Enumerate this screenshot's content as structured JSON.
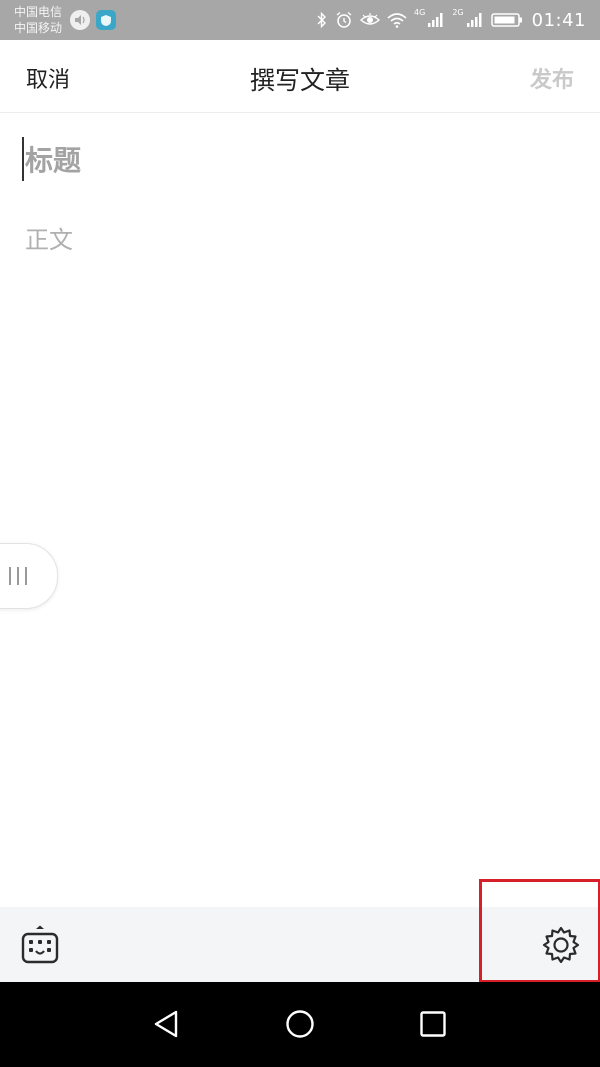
{
  "status_bar": {
    "carrier_primary": "中国电信",
    "carrier_secondary": "中国移动",
    "network_label_1": "4G",
    "network_label_2": "2G",
    "time": "01:41",
    "icons": [
      "volume-icon",
      "shield-icon",
      "bluetooth-icon",
      "alarm-icon",
      "eye-icon",
      "wifi-icon",
      "signal-icon",
      "battery-icon"
    ],
    "background_color": "#a7a7a7"
  },
  "header": {
    "cancel_label": "取消",
    "title": "撰写文章",
    "publish_label": "发布",
    "publish_color": "#c9c9c9"
  },
  "editor": {
    "title_placeholder": "标题",
    "body_placeholder": "正文"
  },
  "side_handle": {
    "icon": "menu-lines-icon"
  },
  "toolbar": {
    "left_icon": "keyboard-icon",
    "right_icon": "settings-gear-icon",
    "highlight_color": "#d71f27"
  },
  "nav_bar": {
    "icons": [
      "back-triangle-icon",
      "home-circle-icon",
      "recent-square-icon"
    ]
  }
}
